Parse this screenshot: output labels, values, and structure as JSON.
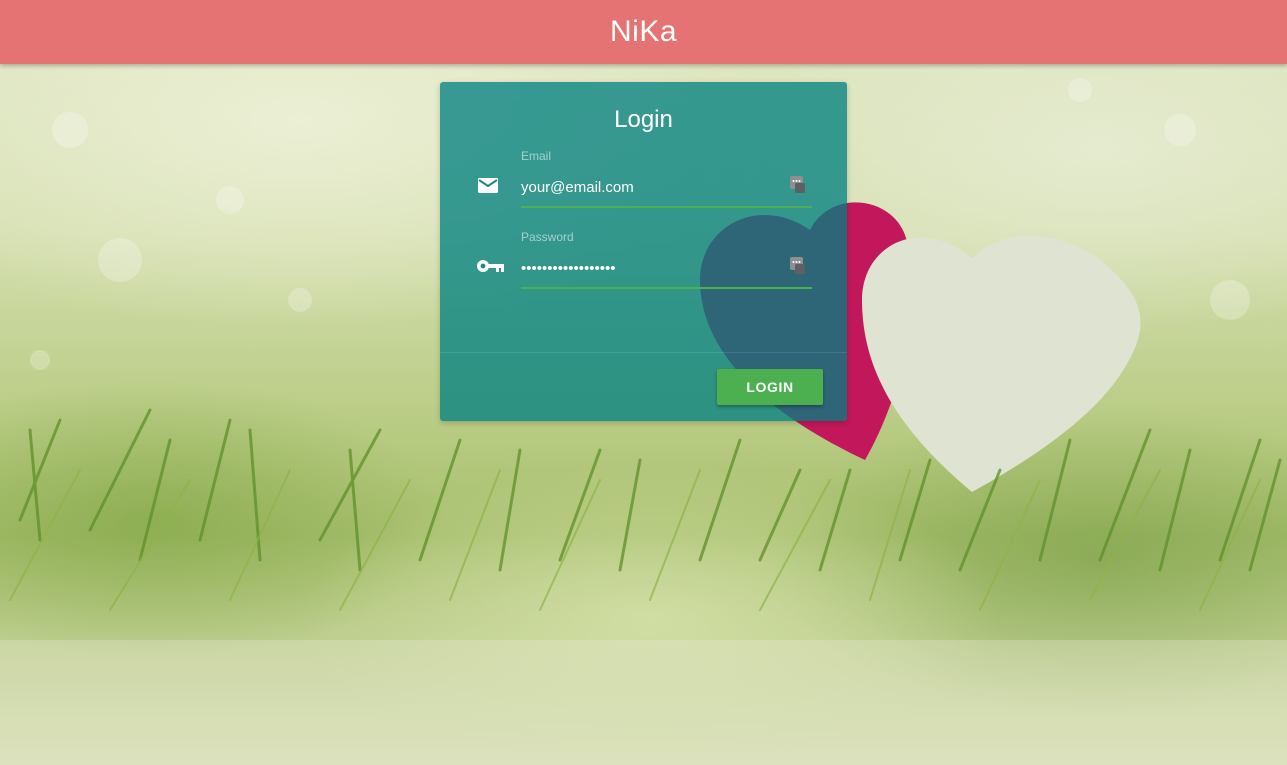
{
  "appbar": {
    "brand": "NiKa",
    "color": "#e57373"
  },
  "login_card": {
    "title": "Login",
    "email": {
      "label": "Email",
      "value": "your@email.com",
      "icon": "email-icon"
    },
    "password": {
      "label": "Password",
      "value": "pppppppppppppppppp",
      "icon": "key-icon"
    },
    "autofill_icon": "password-manager-icon",
    "autofill_badge": "2",
    "submit_label": "LOGIN",
    "card_color": "#008080",
    "accent_color": "#4caf50"
  }
}
